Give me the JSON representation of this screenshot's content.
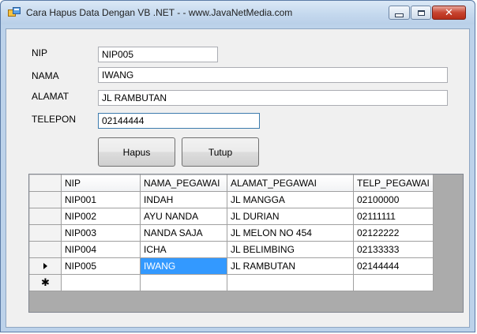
{
  "window": {
    "title": "Cara Hapus Data Dengan VB .NET - - www.JavaNetMedia.com"
  },
  "form": {
    "nip_label": "NIP",
    "nip_value": "NIP005",
    "nama_label": "NAMA",
    "nama_value": "IWANG",
    "alamat_label": "ALAMAT",
    "alamat_value": "JL RAMBUTAN",
    "telepon_label": "TELEPON",
    "telepon_value": "02144444"
  },
  "buttons": {
    "hapus": "Hapus",
    "tutup": "Tutup"
  },
  "grid": {
    "columns": [
      "NIP",
      "NAMA_PEGAWAI",
      "ALAMAT_PEGAWAI",
      "TELP_PEGAWAI"
    ],
    "rows": [
      [
        "NIP001",
        "INDAH",
        "JL MANGGA",
        "02100000"
      ],
      [
        "NIP002",
        "AYU NANDA",
        "JL DURIAN",
        "02111111"
      ],
      [
        "NIP003",
        "NANDA SAJA",
        "JL MELON NO 454",
        "02122222"
      ],
      [
        "NIP004",
        "ICHA",
        "JL BELIMBING",
        "02133333"
      ],
      [
        "NIP005",
        "IWANG",
        "JL RAMBUTAN",
        "02144444"
      ]
    ],
    "current_row_glyph": "▸",
    "new_row_glyph": "✱"
  }
}
